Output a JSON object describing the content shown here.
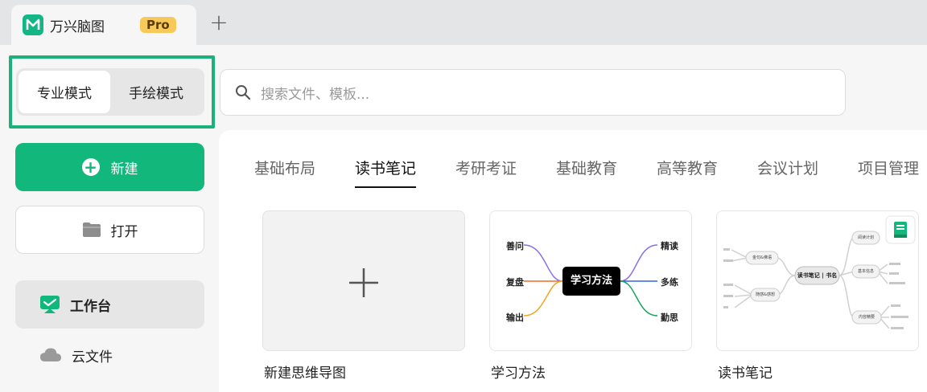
{
  "app": {
    "title": "万兴脑图",
    "badge": "Pro",
    "new_tab_icon": "+"
  },
  "mode_switch": {
    "professional": "专业模式",
    "hand_drawn": "手绘模式",
    "selected": "专业模式"
  },
  "search": {
    "placeholder": "搜索文件、模板..."
  },
  "sidebar": {
    "new_label": "新建",
    "open_label": "打开",
    "items": [
      {
        "label": "工作台",
        "icon": "workbench-icon",
        "active": true
      },
      {
        "label": "云文件",
        "icon": "cloud-icon",
        "active": false
      }
    ]
  },
  "categories": [
    "基础布局",
    "读书笔记",
    "考研考证",
    "基础教育",
    "高等教育",
    "会议计划",
    "项目管理"
  ],
  "active_category": "读书笔记",
  "templates": [
    {
      "label": "新建思维导图"
    },
    {
      "label": "学习方法",
      "center": "学习方法",
      "left_nodes": [
        "善问",
        "复盘",
        "输出"
      ],
      "right_nodes": [
        "精读",
        "多练",
        "勤思"
      ]
    },
    {
      "label": "读书笔记",
      "center": "读书笔记 | 书名",
      "left_nodes": [
        "金句&佛语",
        "随感&感想"
      ],
      "right_nodes": [
        "阅读计划",
        "基本信息",
        "内容精要"
      ]
    }
  ],
  "colors": {
    "brand_green": "#12b77c",
    "highlight_outline": "#1ab27a",
    "pro_badge": "#f7c95a"
  }
}
